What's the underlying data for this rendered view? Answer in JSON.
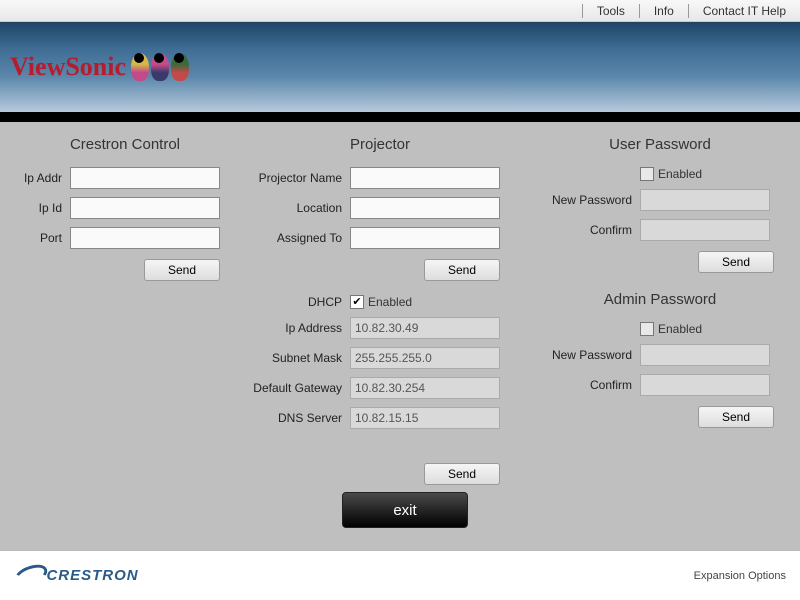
{
  "topnav": {
    "tools": "Tools",
    "info": "Info",
    "contact": "Contact IT Help"
  },
  "brand": "ViewSonic",
  "sections": {
    "crestron": {
      "title": "Crestron Control",
      "ip_addr_label": "Ip Addr",
      "ip_addr": "",
      "ip_id_label": "Ip Id",
      "ip_id": "",
      "port_label": "Port",
      "port": "",
      "send": "Send"
    },
    "projector": {
      "title": "Projector",
      "name_label": "Projector Name",
      "name": "",
      "location_label": "Location",
      "location": "",
      "assigned_label": "Assigned To",
      "assigned": "",
      "send1": "Send",
      "dhcp_label": "DHCP",
      "dhcp_enabled_label": "Enabled",
      "dhcp_checked": true,
      "ip_label": "Ip Address",
      "ip": "10.82.30.49",
      "subnet_label": "Subnet Mask",
      "subnet": "255.255.255.0",
      "gateway_label": "Default Gateway",
      "gateway": "10.82.30.254",
      "dns_label": "DNS Server",
      "dns": "10.82.15.15",
      "send2": "Send"
    },
    "user": {
      "title": "User Password",
      "enabled_label": "Enabled",
      "enabled": false,
      "new_label": "New Password",
      "new": "",
      "confirm_label": "Confirm",
      "confirm": "",
      "send": "Send"
    },
    "admin": {
      "title": "Admin Password",
      "enabled_label": "Enabled",
      "enabled": false,
      "new_label": "New Password",
      "new": "",
      "confirm_label": "Confirm",
      "confirm": "",
      "send": "Send"
    }
  },
  "exit": "exit",
  "footer": {
    "brand": "CRESTRON",
    "expansion": "Expansion Options"
  }
}
